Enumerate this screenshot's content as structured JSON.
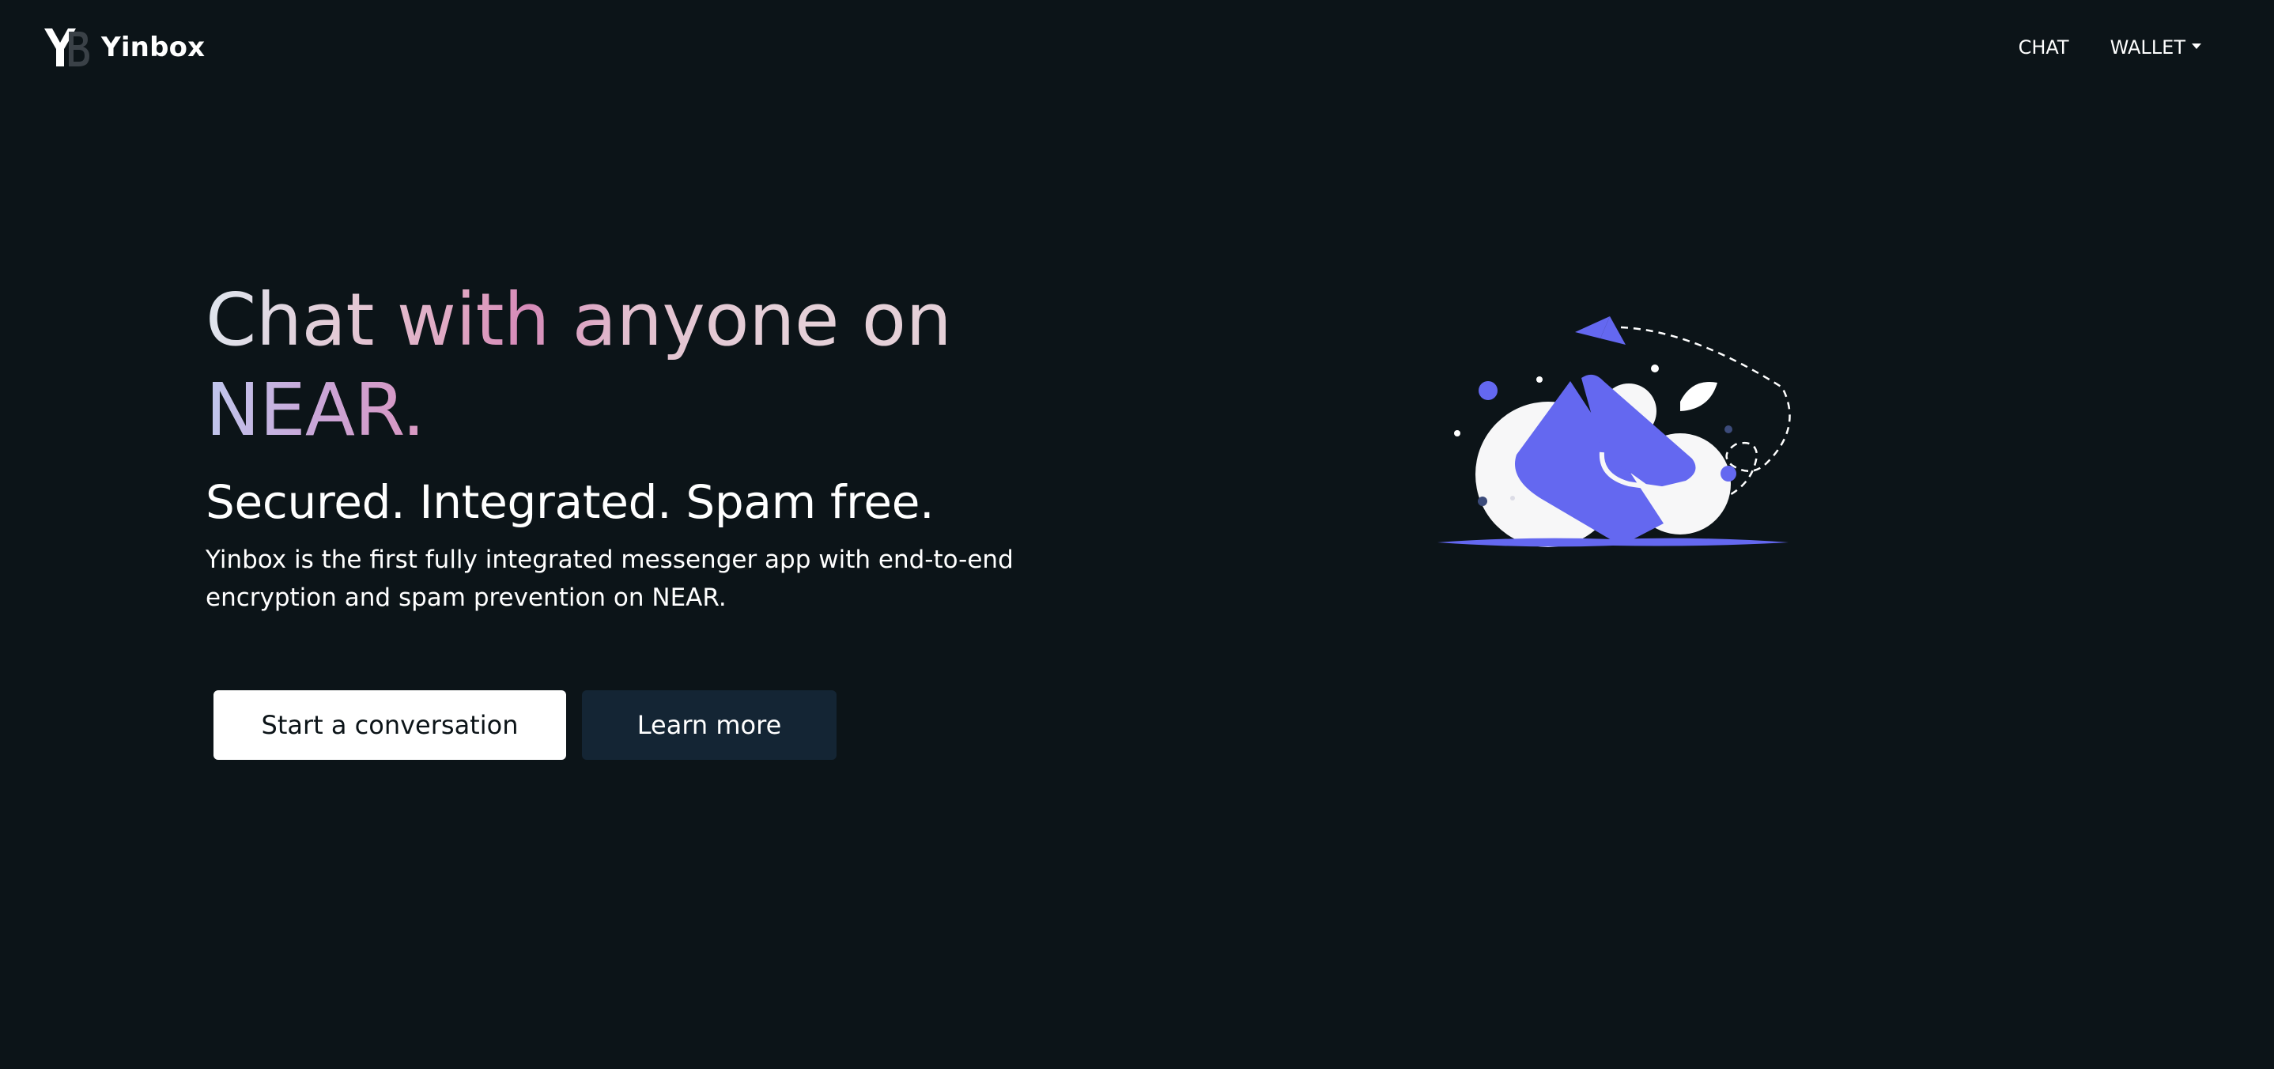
{
  "brand": {
    "name": "Yinbox",
    "logo_icon": "yb-logo-icon"
  },
  "nav": {
    "chat_label": "CHAT",
    "wallet_label": "WALLET"
  },
  "hero": {
    "headline_line1": "Chat with anyone on",
    "headline_line2": "NEAR.",
    "tagline": "Secured. Integrated. Spam free.",
    "description": "Yinbox is the first fully integrated messenger app with end-to-end encryption and spam prevention on NEAR.",
    "primary_button": "Start a conversation",
    "secondary_button": "Learn more",
    "illustration_icon": "mail-envelope-paper-plane-illustration"
  },
  "colors": {
    "background": "#0c1418",
    "accent": "#6468f0",
    "secondary_button_bg": "#142534",
    "primary_button_bg": "#ffffff"
  }
}
